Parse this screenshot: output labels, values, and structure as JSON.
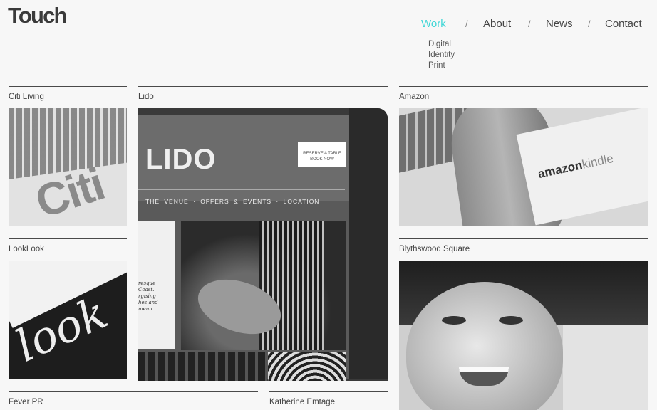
{
  "brand": {
    "logo": "Touch"
  },
  "nav": {
    "items": [
      {
        "label": "Work",
        "active": true
      },
      {
        "label": "About"
      },
      {
        "label": "News"
      },
      {
        "label": "Contact"
      }
    ],
    "separator": "/",
    "active_color": "#3fd6d6"
  },
  "subnav": {
    "items": [
      "Digital",
      "Identity",
      "Print"
    ]
  },
  "projects": [
    {
      "title": "Citi Living",
      "thumb_text": "Citi"
    },
    {
      "title": "Lido",
      "thumb_text": "LIDO",
      "reserve": "RESERVE A TABLE",
      "book": "BOOK NOW",
      "menu": "THE VENUE  ·  OFFERS & EVENTS  ·  LOCATION",
      "blurb": "resque\nCoast.\nrgising\nhes and\nmenu."
    },
    {
      "title": "Amazon",
      "brand_a": "amazon",
      "brand_b": "kindle"
    },
    {
      "title": "LookLook",
      "thumb_text": "look"
    },
    {
      "title": "Blythswood Square"
    },
    {
      "title": "Fever PR"
    },
    {
      "title": "Katherine Emtage"
    }
  ]
}
